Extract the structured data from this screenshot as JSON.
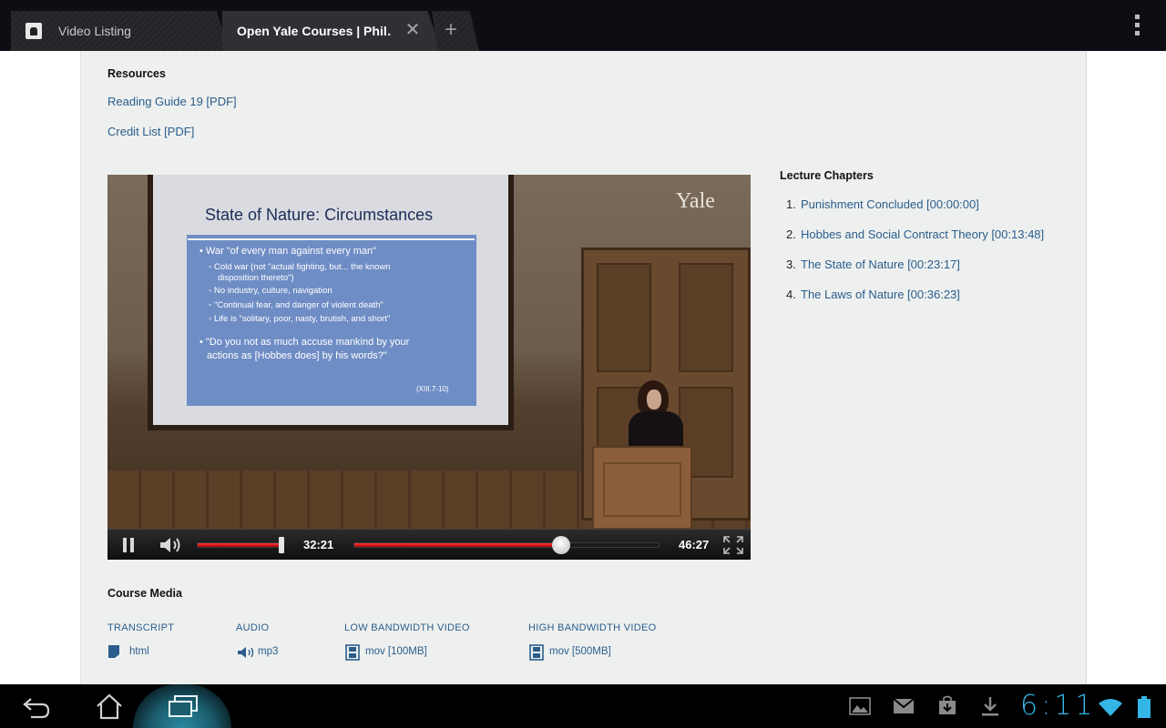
{
  "tabs": [
    {
      "label": "Video Listing",
      "active": false
    },
    {
      "label": "Open Yale Courses | Phil…",
      "active": true
    }
  ],
  "resources": {
    "heading": "Resources",
    "links": [
      "Reading Guide 19 [PDF]",
      "Credit List [PDF]"
    ]
  },
  "video": {
    "slide_title": "State of Nature: Circumstances",
    "slide_lines": [
      "• War \"of every man against every man\"",
      "◦ Cold war (not \"actual fighting, but... the known",
      "disposition thereto\")",
      "◦ No industry, culture, navigation",
      "◦ \"Continual fear, and danger of violent death\"",
      "◦ Life is \"solitary, poor, nasty, brutish, and short\"",
      "• \"Do you not as much accuse mankind by your",
      "actions as [Hobbes does] by his words?\"",
      "(XIII.7-10)"
    ],
    "watermark": "Yale",
    "current_time": "32:21",
    "duration": "46:27",
    "volume_level": 0.97,
    "progress": 0.68
  },
  "chapters": {
    "heading": "Lecture Chapters",
    "items": [
      {
        "num": "1.",
        "label": "Punishment Concluded [00:00:00]"
      },
      {
        "num": "2.",
        "label": "Hobbes and Social Contract Theory [00:13:48]"
      },
      {
        "num": "3.",
        "label": "The State of Nature [00:23:17]"
      },
      {
        "num": "4.",
        "label": "The Laws of Nature [00:36:23]"
      }
    ]
  },
  "media": {
    "heading": "Course Media",
    "columns": [
      {
        "header": "TRANSCRIPT",
        "link": "html",
        "icon": "document-icon"
      },
      {
        "header": "AUDIO",
        "link": "mp3",
        "icon": "speaker-icon"
      },
      {
        "header": "LOW BANDWIDTH VIDEO",
        "link": "mov [100MB]",
        "icon": "film-icon"
      },
      {
        "header": "HIGH BANDWIDTH VIDEO",
        "link": "mov [500MB]",
        "icon": "film-icon"
      }
    ]
  },
  "system": {
    "clock": "6:11",
    "accent": "#33b5e5",
    "link_color": "#2a5d8c"
  }
}
